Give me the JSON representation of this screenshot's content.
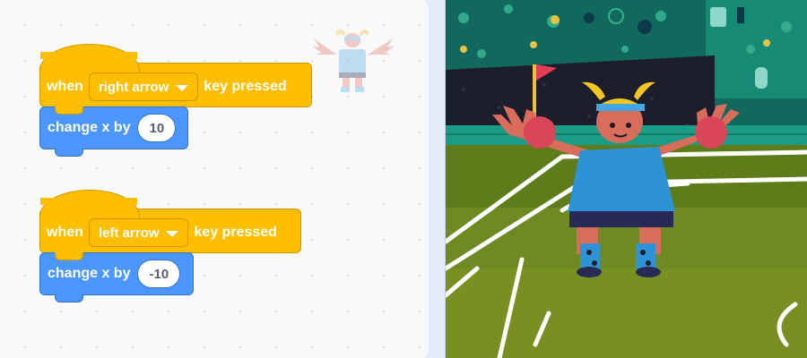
{
  "scripts": [
    {
      "hat": {
        "prefix": "when",
        "key": "right arrow",
        "suffix": "key pressed"
      },
      "motion": {
        "label": "change x by",
        "value": "10"
      }
    },
    {
      "hat": {
        "prefix": "when",
        "key": "left arrow",
        "suffix": "key pressed"
      },
      "motion": {
        "label": "change x by",
        "value": "-10"
      }
    }
  ],
  "colors": {
    "events_block": "#ffbf00",
    "motion_block": "#4c97ff",
    "field": "#3a8f1e"
  },
  "icons": [
    "dropdown-caret-icon",
    "sprite-thumbnail",
    "corner-flag-icon"
  ]
}
